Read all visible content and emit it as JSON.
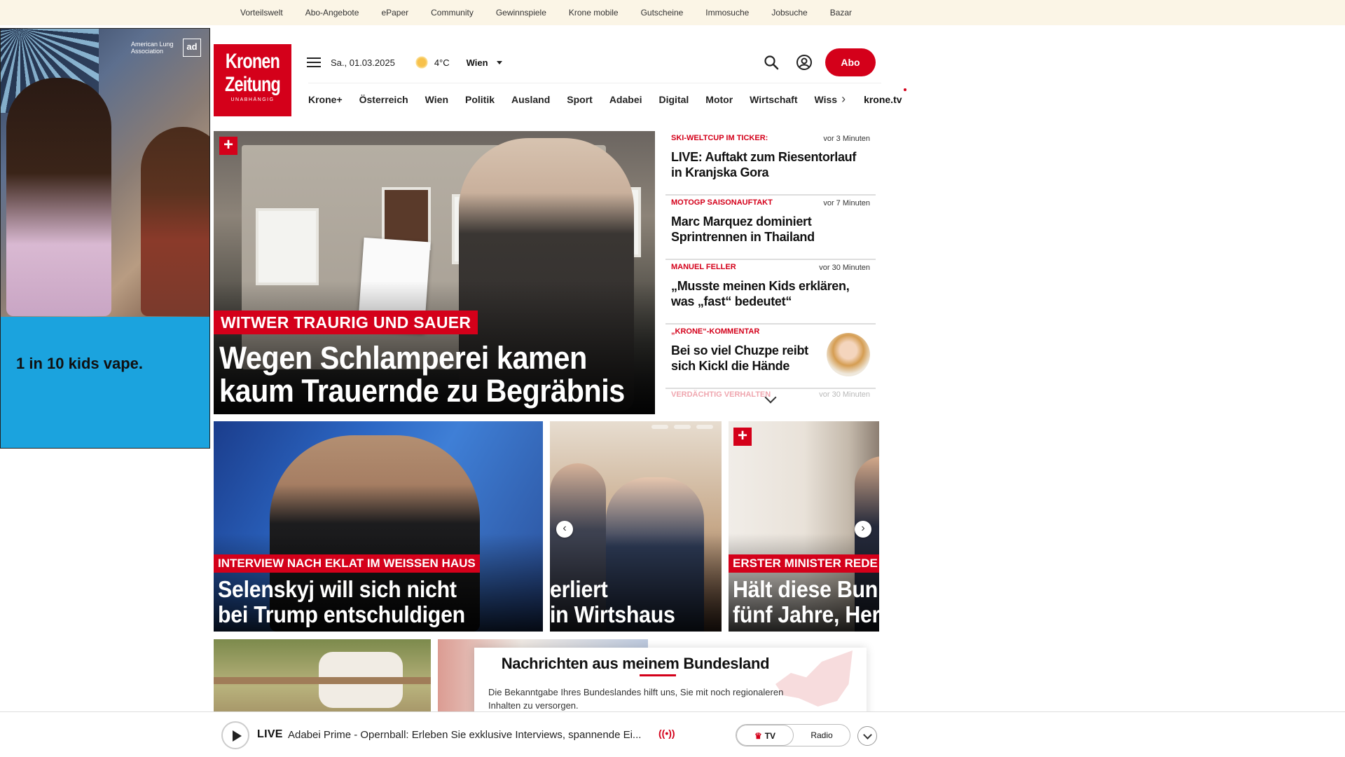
{
  "topbar": {
    "items": [
      "Vorteilswelt",
      "Abo-Angebote",
      "ePaper",
      "Community",
      "Gewinnspiele",
      "Krone mobile",
      "Gutscheine",
      "Immosuche",
      "Jobsuche",
      "Bazar"
    ]
  },
  "ad": {
    "sponsor": "American Lung Association",
    "badge": "ad",
    "text": "1 in 10 kids vape."
  },
  "logo": {
    "line1": "Kronen",
    "line2": "Zeitung",
    "tagline": "UNABHÄNGIG"
  },
  "header": {
    "date": "Sa., 01.03.2025",
    "weather_icon": "sun-icon",
    "temperature": "4°C",
    "city": "Wien",
    "abo_label": "Abo"
  },
  "nav": {
    "items": [
      "Krone+",
      "Österreich",
      "Wien",
      "Politik",
      "Ausland",
      "Sport",
      "Adabei",
      "Digital",
      "Motor",
      "Wirtschaft"
    ],
    "faded": "Wiss",
    "kronetv": "krone.tv"
  },
  "hero": {
    "kicker": "WITWER TRAURIG UND SAUER",
    "headline_line1": "Wegen Schlamperei kamen",
    "headline_line2": "kaum Trauernde zu Begräbnis"
  },
  "ticker": [
    {
      "kicker": "SKI-WELTCUP IM TICKER:",
      "time": "vor 3 Minuten",
      "title": "LIVE: Auftakt zum Riesentorlauf in Kranjska Gora"
    },
    {
      "kicker": "MOTOGP SAISONAUFTAKT",
      "time": "vor 7 Minuten",
      "title": "Marc Marquez dominiert Sprintrennen in Thailand"
    },
    {
      "kicker": "MANUEL FELLER",
      "time": "vor 30 Minuten",
      "title": "„Musste meinen Kids erklären, was „fast“ bedeutet“"
    },
    {
      "kicker": "„KRONE“-KOMMENTAR",
      "time": "",
      "title": "Bei so viel Chuzpe reibt sich Kickl die Hände"
    }
  ],
  "ticker_more": {
    "kicker": "VERDÄCHTIG VERHALTEN",
    "time": "vor 30 Minuten"
  },
  "tiles": [
    {
      "kicker": "INTERVIEW NACH EKLAT IM WEISSEN HAUS",
      "line1": "Selenskyj will sich nicht",
      "line2": "bei Trump entschuldigen"
    },
    {
      "kicker": "",
      "line1": "erliert",
      "line2": "in Wirtshaus"
    },
    {
      "kicker": "ERSTER MINISTER REDE",
      "line1": "Hält diese Bun",
      "line2": "fünf Jahre, Her"
    }
  ],
  "popup": {
    "title": "Nachrichten aus meinem Bundesland",
    "text": "Die Bekanntgabe Ihres Bundeslandes hilft uns, Sie mit noch regionaleren Inhalten zu versorgen."
  },
  "player": {
    "live_label": "LIVE",
    "title": "Adabei Prime - Opernball: Erleben Sie exklusive Interviews, spannende Ei...",
    "tv_label": "TV",
    "radio_label": "Radio"
  },
  "colors": {
    "brand_red": "#d4001a",
    "topbar_bg": "#fbf5e6",
    "ad_blue": "#1ba3de"
  }
}
